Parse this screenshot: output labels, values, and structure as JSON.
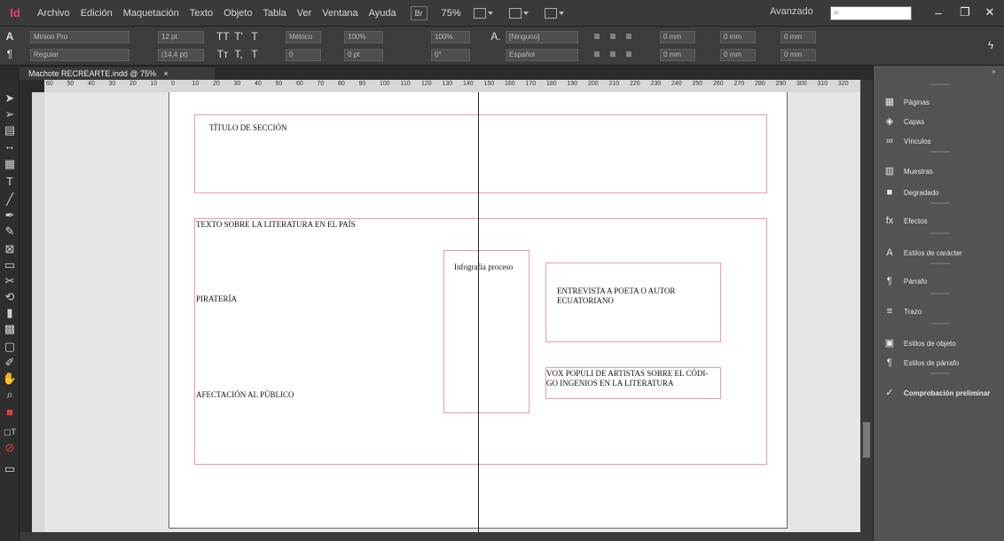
{
  "app": {
    "logo_text": "Id"
  },
  "menu": [
    "Archivo",
    "Edición",
    "Maquetación",
    "Texto",
    "Objeto",
    "Tabla",
    "Ver",
    "Ventana",
    "Ayuda"
  ],
  "bridge_label": "Br",
  "zoom_label": "75%",
  "workspace": "Avanzado",
  "control_panel": {
    "font_family": "Minion Pro",
    "font_style": "Regular",
    "font_size": "12 pt",
    "leading": "(14,4 pt)",
    "kerning": "Métrico",
    "tracking": "0",
    "vertical_scale": "100%",
    "horizontal_scale": "100%",
    "baseline_shift": "0 pt",
    "skew": "0°",
    "char_style": "[Ninguno]",
    "language": "Español",
    "indent_values": [
      "0 mm",
      "0 mm",
      "0 mm",
      "0 mm",
      "0 mm",
      "0 mm"
    ]
  },
  "document": {
    "tab_title": "Machote RECREARTE.indd @ 75%"
  },
  "ruler": {
    "marks": [
      "60",
      "50",
      "40",
      "30",
      "20",
      "10",
      "0",
      "10",
      "20",
      "30",
      "40",
      "50",
      "60",
      "70",
      "80",
      "90",
      "100",
      "110",
      "120",
      "130",
      "140",
      "150",
      "160",
      "170",
      "180",
      "190",
      "200",
      "210",
      "220",
      "230",
      "240",
      "250",
      "260",
      "270",
      "280",
      "290",
      "300",
      "310",
      "320"
    ]
  },
  "frames": {
    "section_title": "TÍTULO DE SECCIÓN",
    "literature_text": "TEXTO  SOBRE  LA LITERATURA EN EL PAÍS",
    "piracy": "PIRATERÍA",
    "public_impact": "AFECTACIÓN AL PÚBLICO",
    "infographic": "Infografía proceso",
    "interview_line1": "ENTREVISTA A POETA O AUTOR",
    "interview_line2": "ECUATORIANO",
    "vox_line1": "VOX POPULI DE ARTISTAS SOBRE EL CÓDI-",
    "vox_line2": "GO INGENIOS EN LA LITERATURA"
  },
  "panels": [
    {
      "label": "Páginas",
      "icon": "pages-icon",
      "glyph": "▦"
    },
    {
      "label": "Capas",
      "icon": "layers-icon",
      "glyph": "◈"
    },
    {
      "label": "Vínculos",
      "icon": "links-icon",
      "glyph": "∞"
    },
    {
      "label": "Muestras",
      "icon": "swatches-icon",
      "glyph": "▥"
    },
    {
      "label": "Degradado",
      "icon": "gradient-icon",
      "glyph": "■"
    },
    {
      "label": "Efectos",
      "icon": "effects-icon",
      "glyph": "fx"
    },
    {
      "label": "Estilos de carácter",
      "icon": "character-styles-icon",
      "glyph": "A"
    },
    {
      "label": "Párrafo",
      "icon": "paragraph-icon",
      "glyph": "¶"
    },
    {
      "label": "Trazo",
      "icon": "stroke-icon",
      "glyph": "≡"
    },
    {
      "label": "Estilos de objeto",
      "icon": "object-styles-icon",
      "glyph": "▣"
    },
    {
      "label": "Estilos de párrafo",
      "icon": "paragraph-styles-icon",
      "glyph": "¶"
    },
    {
      "label": "Comprobación preliminar",
      "icon": "preflight-icon",
      "glyph": "✓"
    }
  ],
  "colors": {
    "accent": "#ee3b73",
    "frame_border": "#ef9aaa",
    "panel_bg": "#535353"
  }
}
